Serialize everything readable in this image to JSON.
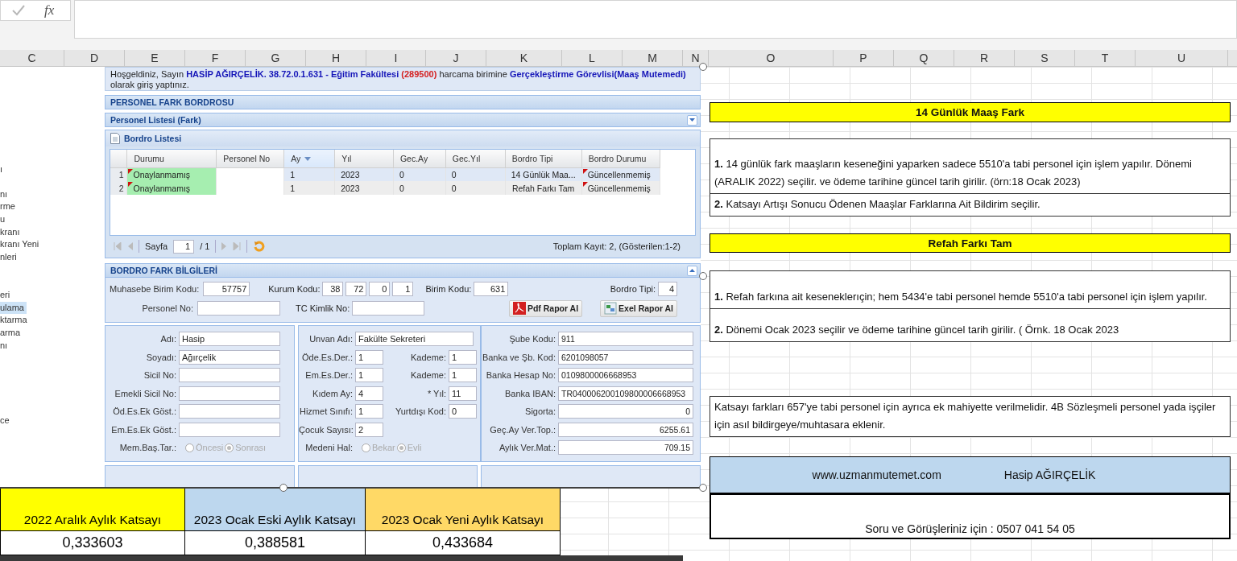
{
  "formula_bar": {
    "function_label": "fx"
  },
  "column_headers": [
    "C",
    "D",
    "E",
    "F",
    "G",
    "H",
    "I",
    "J",
    "K",
    "L",
    "M",
    "N",
    "O",
    "P",
    "Q",
    "R",
    "S",
    "T",
    "U"
  ],
  "sidebar": {
    "items": [
      {
        "label": "ı",
        "selected": false
      },
      {
        "label": "nı",
        "selected": false
      },
      {
        "label": "rme",
        "selected": false
      },
      {
        "label": "u",
        "selected": false
      },
      {
        "label": "kranı",
        "selected": false
      },
      {
        "label": "kranı Yeni",
        "selected": false
      },
      {
        "label": "nleri",
        "selected": false
      },
      {
        "label": "eri",
        "selected": false
      },
      {
        "label": "ulama",
        "selected": true
      },
      {
        "label": "ktarma",
        "selected": false
      },
      {
        "label": "arma",
        "selected": false
      },
      {
        "label": "nı",
        "selected": false
      },
      {
        "label": "ce",
        "selected": false
      }
    ]
  },
  "app": {
    "welcome": [
      {
        "kind": "plain",
        "text": "Hoşgeldiniz, Sayın"
      },
      {
        "kind": "highlight",
        "text": "HASİP AĞIRÇELİK. 38.72.0.1.631 - Eğitim Fakültesi"
      },
      {
        "kind": "code",
        "text": "(289500)"
      },
      {
        "kind": "plain",
        "text": "harcama birimine"
      },
      {
        "kind": "highlight",
        "text": "Gerçekleştirme Görevlisi(Maaş Mutemedi)"
      },
      {
        "kind": "plain",
        "text": "olarak giriş yaptınız."
      }
    ],
    "section_title": "PERSONEL FARK BORDROSU",
    "list_panel": {
      "title": "Personel Listesi (Fark)"
    },
    "grid": {
      "title": "Bordro Listesi",
      "columns": [
        {
          "label": "Durumu",
          "sorted": false
        },
        {
          "label": "Personel No",
          "sorted": false
        },
        {
          "label": "Ay",
          "sorted": true
        },
        {
          "label": "Yıl",
          "sorted": false
        },
        {
          "label": "Gec.Ay",
          "sorted": false
        },
        {
          "label": "Gec.Yıl",
          "sorted": false
        },
        {
          "label": "Bordro Tipi",
          "sorted": false
        },
        {
          "label": "Bordro Durumu",
          "sorted": false
        }
      ],
      "rows": [
        {
          "number": "1",
          "selected": true,
          "edited": true,
          "durumu": "Onaylanmamış",
          "ay": "1",
          "yil": "2023",
          "gec_ay": "0",
          "gec_yil": "0",
          "bordro_tipi": "14 Günlük Maa...",
          "bordro_durumu": "Güncellenmemiş"
        },
        {
          "number": "2",
          "selected": false,
          "edited": true,
          "durumu": "Onaylanmamış",
          "ay": "1",
          "yil": "2023",
          "gec_ay": "0",
          "gec_yil": "0",
          "bordro_tipi": "Refah Farkı Tam",
          "bordro_durumu": "Güncellenmemiş"
        }
      ]
    },
    "paging": {
      "page_label": "Sayfa",
      "page": "1",
      "page_count": "/ 1",
      "summary": "Toplam Kayıt: 2, (Gösterilen:1-2)"
    },
    "details": {
      "title": "BORDRO FARK BİLGİLERİ",
      "muhasebe_label": "Muhasebe Birim Kodu:",
      "muhasebe": "57757",
      "kurum_label": "Kurum Kodu:",
      "kurum": [
        "38",
        "72",
        "0",
        "1"
      ],
      "birim_label": "Birim Kodu:",
      "birim": "631",
      "bordro_tipi_label": "Bordro Tipi:",
      "bordro_tipi": "4",
      "personel_no_label": "Personel No:",
      "tc_label": "TC Kimlik No:",
      "buttons": [
        {
          "kind": "pdf",
          "label": "Pdf Rapor Al"
        },
        {
          "kind": "excel",
          "label": "Exel Rapor Al"
        }
      ],
      "columns": [
        [
          {
            "kind": "text",
            "label": "Adı:",
            "value": "Hasip"
          },
          {
            "kind": "text",
            "label": "Soyadı:",
            "value": "Ağırçelik"
          },
          {
            "kind": "text",
            "label": "Sicil No:"
          },
          {
            "kind": "text",
            "label": "Emekli Sicil No:"
          },
          {
            "kind": "text",
            "label": "Öd.Es.Ek Göst.:"
          },
          {
            "kind": "text",
            "label": "Em.Es.Ek Göst.:"
          },
          {
            "kind": "radio",
            "label": "Mem.Baş.Tar.:",
            "disabled": true,
            "options": [
              {
                "label": "Öncesi",
                "selected": false
              },
              {
                "label": "Sonrası",
                "selected": true
              }
            ]
          }
        ],
        [
          {
            "kind": "text",
            "label": "Unvan Adı:",
            "value": "Fakülte Sekreteri"
          },
          {
            "kind": "pair",
            "fields": [
              {
                "label": "Öde.Es.Der.:",
                "value": "1"
              },
              {
                "label": "Kademe:",
                "value": "1"
              }
            ]
          },
          {
            "kind": "pair",
            "fields": [
              {
                "label": "Em.Es.Der.:",
                "value": "1"
              },
              {
                "label": "Kademe:",
                "value": "1"
              }
            ]
          },
          {
            "kind": "pair",
            "fields": [
              {
                "label": "Kıdem Ay:",
                "value": "4"
              },
              {
                "label": "* Yıl:",
                "value": "11"
              }
            ]
          },
          {
            "kind": "pair",
            "fields": [
              {
                "label": "Hizmet Sınıfı:",
                "value": "1"
              },
              {
                "label": "Yurtdışı Kod:",
                "value": "0"
              }
            ]
          },
          {
            "kind": "pair",
            "fields": [
              {
                "label": "Çocuk Sayısı:",
                "value": "2"
              }
            ]
          },
          {
            "kind": "radio",
            "label": "Medeni Hal:",
            "disabled": true,
            "options": [
              {
                "label": "Bekar",
                "selected": false
              },
              {
                "label": "Evli",
                "selected": true
              }
            ]
          }
        ],
        [
          {
            "kind": "text",
            "label": "Şube Kodu:",
            "value": "911"
          },
          {
            "kind": "text",
            "label": "Banka ve Şb. Kod:",
            "value": "6201098057"
          },
          {
            "kind": "text",
            "label": "Banka Hesap No:",
            "value": "0109800006668953"
          },
          {
            "kind": "text",
            "label": "Banka IBAN:",
            "value": "TR040006200109800006668953"
          },
          {
            "kind": "number",
            "label": "Sigorta:",
            "value": "0"
          },
          {
            "kind": "number",
            "label": "Geç.Ay Ver.Top.:",
            "value": "6255.61"
          },
          {
            "kind": "number",
            "label": "Aylık Ver.Mat.:",
            "value": "709.15"
          }
        ]
      ]
    }
  },
  "katsayi_table": {
    "columns": [
      {
        "header": "2022 Aralık Aylık Katsayı",
        "color": "#ffff00",
        "value": "0,333603"
      },
      {
        "header": "2023 Ocak Eski Aylık Katsayı",
        "color": "#bdd7ee",
        "value": "0,388581"
      },
      {
        "header": "2023 Ocak Yeni Aylık Katsayı",
        "color": "#ffd966",
        "value": "0,433684"
      }
    ]
  },
  "notes": [
    {
      "kind": "title",
      "text": "14 Günlük Maaş Fark"
    },
    {
      "kind": "note",
      "text": "**1.** 14 günlük fark maaşların keseneğini yaparken sadece 5510'a tabi personel için işlem yapılır. Dönemi (ARALIK 2022) seçilir. ve ödeme tarihine güncel tarih girilir. (örn:18 Ocak 2023)"
    },
    {
      "kind": "note",
      "text": "**2.** Katsayı Artışı Sonucu Ödenen Maaşlar Farklarına Ait Bildirim seçilir."
    },
    {
      "kind": "title",
      "text": "Refah Farkı Tam"
    },
    {
      "kind": "note",
      "text": "**1.** Refah farkına ait keseneklerıçin; hem 5434'e tabi personel hemde 5510'a tabi personel için işlem yapılır."
    },
    {
      "kind": "note",
      "text": "**2.** Dönemi Ocak 2023 seçilir ve ödeme tarihine güncel tarih girilir. ( Örnk. 18 Ocak 2023"
    },
    {
      "kind": "note",
      "text": "Katsayı farkları 657'ye tabi personel için ayrıca ek mahiyette verilmelidir. 4B Sözleşmeli personel yada işçiler için asıl bildirgeye/muhtasara eklenir."
    },
    {
      "kind": "footer",
      "texts": [
        "www.uzmanmutemet.com",
        "Hasip AĞIRÇELİK"
      ]
    },
    {
      "kind": "contact",
      "text": "Soru ve Görüşleriniz için : 0507 041 54 05"
    }
  ]
}
